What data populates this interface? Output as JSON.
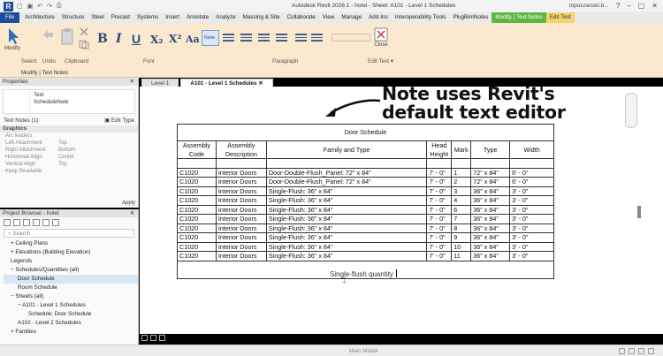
{
  "window": {
    "title": "Autodesk Revit 2026.1 - hotel - Sheet: A101 - Level 1 Schedules",
    "user": "lopuszanski.b...",
    "app_icon_letter": "R"
  },
  "menu": {
    "tabs": [
      "File",
      "Architecture",
      "Structure",
      "Steel",
      "Precast",
      "Systems",
      "Insert",
      "Annotate",
      "Analyze",
      "Massing & Site",
      "Collaborate",
      "View",
      "Manage",
      "Add-Ins",
      "Interoperability Tools",
      "PlugBimNotes",
      "Modify | Text Notes",
      "Edit Text"
    ]
  },
  "ribbon": {
    "modify_label": "Modify",
    "close_label": "Close",
    "font_buttons": [
      "B",
      "I",
      "U",
      "X₂",
      "X²",
      "Aa"
    ],
    "lower_case_placeholder": "",
    "groups": {
      "select": "Select",
      "undo": "Undo",
      "clipboard": "Clipboard",
      "font": "Font",
      "paragraph": "Paragraph",
      "edit_text": "Edit Text ▾"
    },
    "context_status": "Modify | Text Notes"
  },
  "properties": {
    "title": "Properties",
    "type_name": [
      "Text",
      "ScheduleNote"
    ],
    "selector": "Text Notes (1)",
    "edit_type": "Edit Type",
    "section": "Graphics",
    "rows": [
      {
        "k": "Arc leaders",
        "v": ""
      },
      {
        "k": "Left Attachment",
        "v": "Top"
      },
      {
        "k": "Right Attachment",
        "v": "Bottom"
      },
      {
        "k": "Horizontal Align",
        "v": "Center"
      },
      {
        "k": "Vertical Align",
        "v": "Top"
      },
      {
        "k": "Keep Readable",
        "v": ""
      }
    ],
    "apply": "Apply"
  },
  "project_browser": {
    "title": "Project Browser - hotel",
    "search_placeholder": "Search",
    "items": [
      {
        "label": "+ Ceiling Plans",
        "indent": 1,
        "selected": false
      },
      {
        "label": "+ Elevations (Building Elevation)",
        "indent": 1,
        "selected": false
      },
      {
        "label": "Legends",
        "indent": 1,
        "selected": false
      },
      {
        "label": "− Schedules/Quantities (all)",
        "indent": 1,
        "selected": false
      },
      {
        "label": "Door Schedule",
        "indent": 2,
        "selected": true
      },
      {
        "label": "Room Schedule",
        "indent": 2,
        "selected": false
      },
      {
        "label": "− Sheets (all)",
        "indent": 1,
        "selected": false
      },
      {
        "label": "− A101 - Level 1 Schedules",
        "indent": 2,
        "selected": false
      },
      {
        "label": "Schedule: Door Schedule",
        "indent": 3,
        "selected": false
      },
      {
        "label": "A102 - Level 2 Schedules",
        "indent": 2,
        "selected": false
      },
      {
        "label": "+ Families",
        "indent": 1,
        "selected": false
      }
    ]
  },
  "doc_tabs": [
    "Level 1",
    "A101 - Level 1 Schedules"
  ],
  "callout": {
    "line1": "Note uses Revit's",
    "line2": "default text editor"
  },
  "schedule": {
    "title": "Door Schedule",
    "headers": [
      "Assembly Code",
      "Assembly Description",
      "Family and Type",
      "Head Height",
      "Mark",
      "Type",
      "Width"
    ],
    "rows": [
      [
        "C1020",
        "Interior Doors",
        "Door-Double-Flush_Panel: 72\" x 84\"",
        "7' - 0\"",
        "1",
        "72\" x 84\"",
        "6' - 0\""
      ],
      [
        "C1020",
        "Interior Doors",
        "Door-Double-Flush_Panel: 72\" x 84\"",
        "7' - 0\"",
        "2",
        "72\" x 84\"",
        "6' - 0\""
      ],
      [
        "C1020",
        "Interior Doors",
        "Single-Flush: 36\" x 84\"",
        "7' - 0\"",
        "3",
        "36\" x 84\"",
        "3' - 0\""
      ],
      [
        "C1020",
        "Interior Doors",
        "Single-Flush: 36\" x 84\"",
        "7' - 0\"",
        "4",
        "36\" x 84\"",
        "3' - 0\""
      ],
      [
        "C1020",
        "Interior Doors",
        "Single-Flush: 36\" x 84\"",
        "7' - 0\"",
        "6",
        "36\" x 84\"",
        "3' - 0\""
      ],
      [
        "C1020",
        "Interior Doors",
        "Single-Flush: 36\" x 84\"",
        "7' - 0\"",
        "7",
        "36\" x 84\"",
        "3' - 0\""
      ],
      [
        "C1020",
        "Interior Doors",
        "Single-Flush: 36\" x 84\"",
        "7' - 0\"",
        "8",
        "36\" x 84\"",
        "3' - 0\""
      ],
      [
        "C1020",
        "Interior Doors",
        "Single-Flush: 36\" x 84\"",
        "7' - 0\"",
        "9",
        "36\" x 84\"",
        "3' - 0\""
      ],
      [
        "C1020",
        "Interior Doors",
        "Single-Flush: 36\" x 84\"",
        "7' - 0\"",
        "10",
        "36\" x 84\"",
        "3' - 0\""
      ],
      [
        "C1020",
        "Interior Doors",
        "Single-Flush: 36\" x 84\"",
        "7' - 0\"",
        "11",
        "36\" x 84\"",
        "3' - 0\""
      ]
    ],
    "note": "Single-flush quantity"
  },
  "statusbar": {
    "model": "Main Model"
  },
  "colors": {
    "ribbon_bg": "#fbe9cf",
    "file_tab": "#1b4f9c",
    "modify_tab": "#5fb544",
    "edit_tab": "#f3d36f"
  }
}
